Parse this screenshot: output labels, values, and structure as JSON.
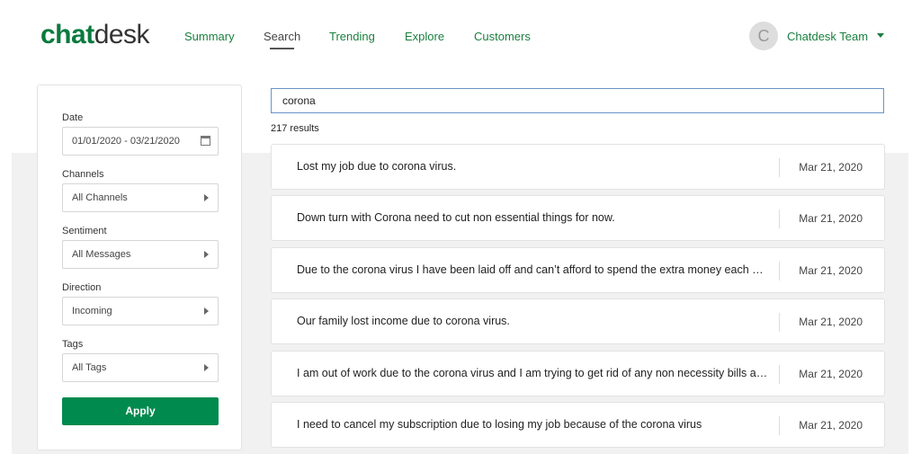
{
  "logo": {
    "part1": "chat",
    "part2": "desk"
  },
  "nav": [
    {
      "label": "Summary"
    },
    {
      "label": "Search",
      "active": true
    },
    {
      "label": "Trending"
    },
    {
      "label": "Explore"
    },
    {
      "label": "Customers"
    }
  ],
  "user": {
    "initial": "C",
    "name": "Chatdesk Team"
  },
  "filters": {
    "date": {
      "label": "Date",
      "value": "01/01/2020 - 03/21/2020"
    },
    "channels": {
      "label": "Channels",
      "value": "All Channels"
    },
    "sentiment": {
      "label": "Sentiment",
      "value": "All Messages"
    },
    "direction": {
      "label": "Direction",
      "value": "Incoming"
    },
    "tags": {
      "label": "Tags",
      "value": "All Tags"
    },
    "apply": "Apply"
  },
  "search": {
    "value": "corona",
    "count": "217 results"
  },
  "results": [
    {
      "text": "Lost my job due to corona virus.",
      "date": "Mar 21, 2020"
    },
    {
      "text": "Down turn with Corona need to cut non essential things for now.",
      "date": "Mar 21, 2020"
    },
    {
      "text": "Due to the corona virus I have been laid off and can’t afford to spend the extra money each month",
      "date": "Mar 21, 2020"
    },
    {
      "text": "Our family lost income due to corona virus.",
      "date": "Mar 21, 2020"
    },
    {
      "text": "I am out of work due to the corona virus and I am trying to get rid of any non necessity bills at this time",
      "date": "Mar 21, 2020"
    },
    {
      "text": "I need to cancel my subscription due to losing my job because of the corona virus",
      "date": "Mar 21, 2020"
    }
  ],
  "colors": {
    "brand": "#0a7a3e",
    "button": "#008a4e"
  }
}
